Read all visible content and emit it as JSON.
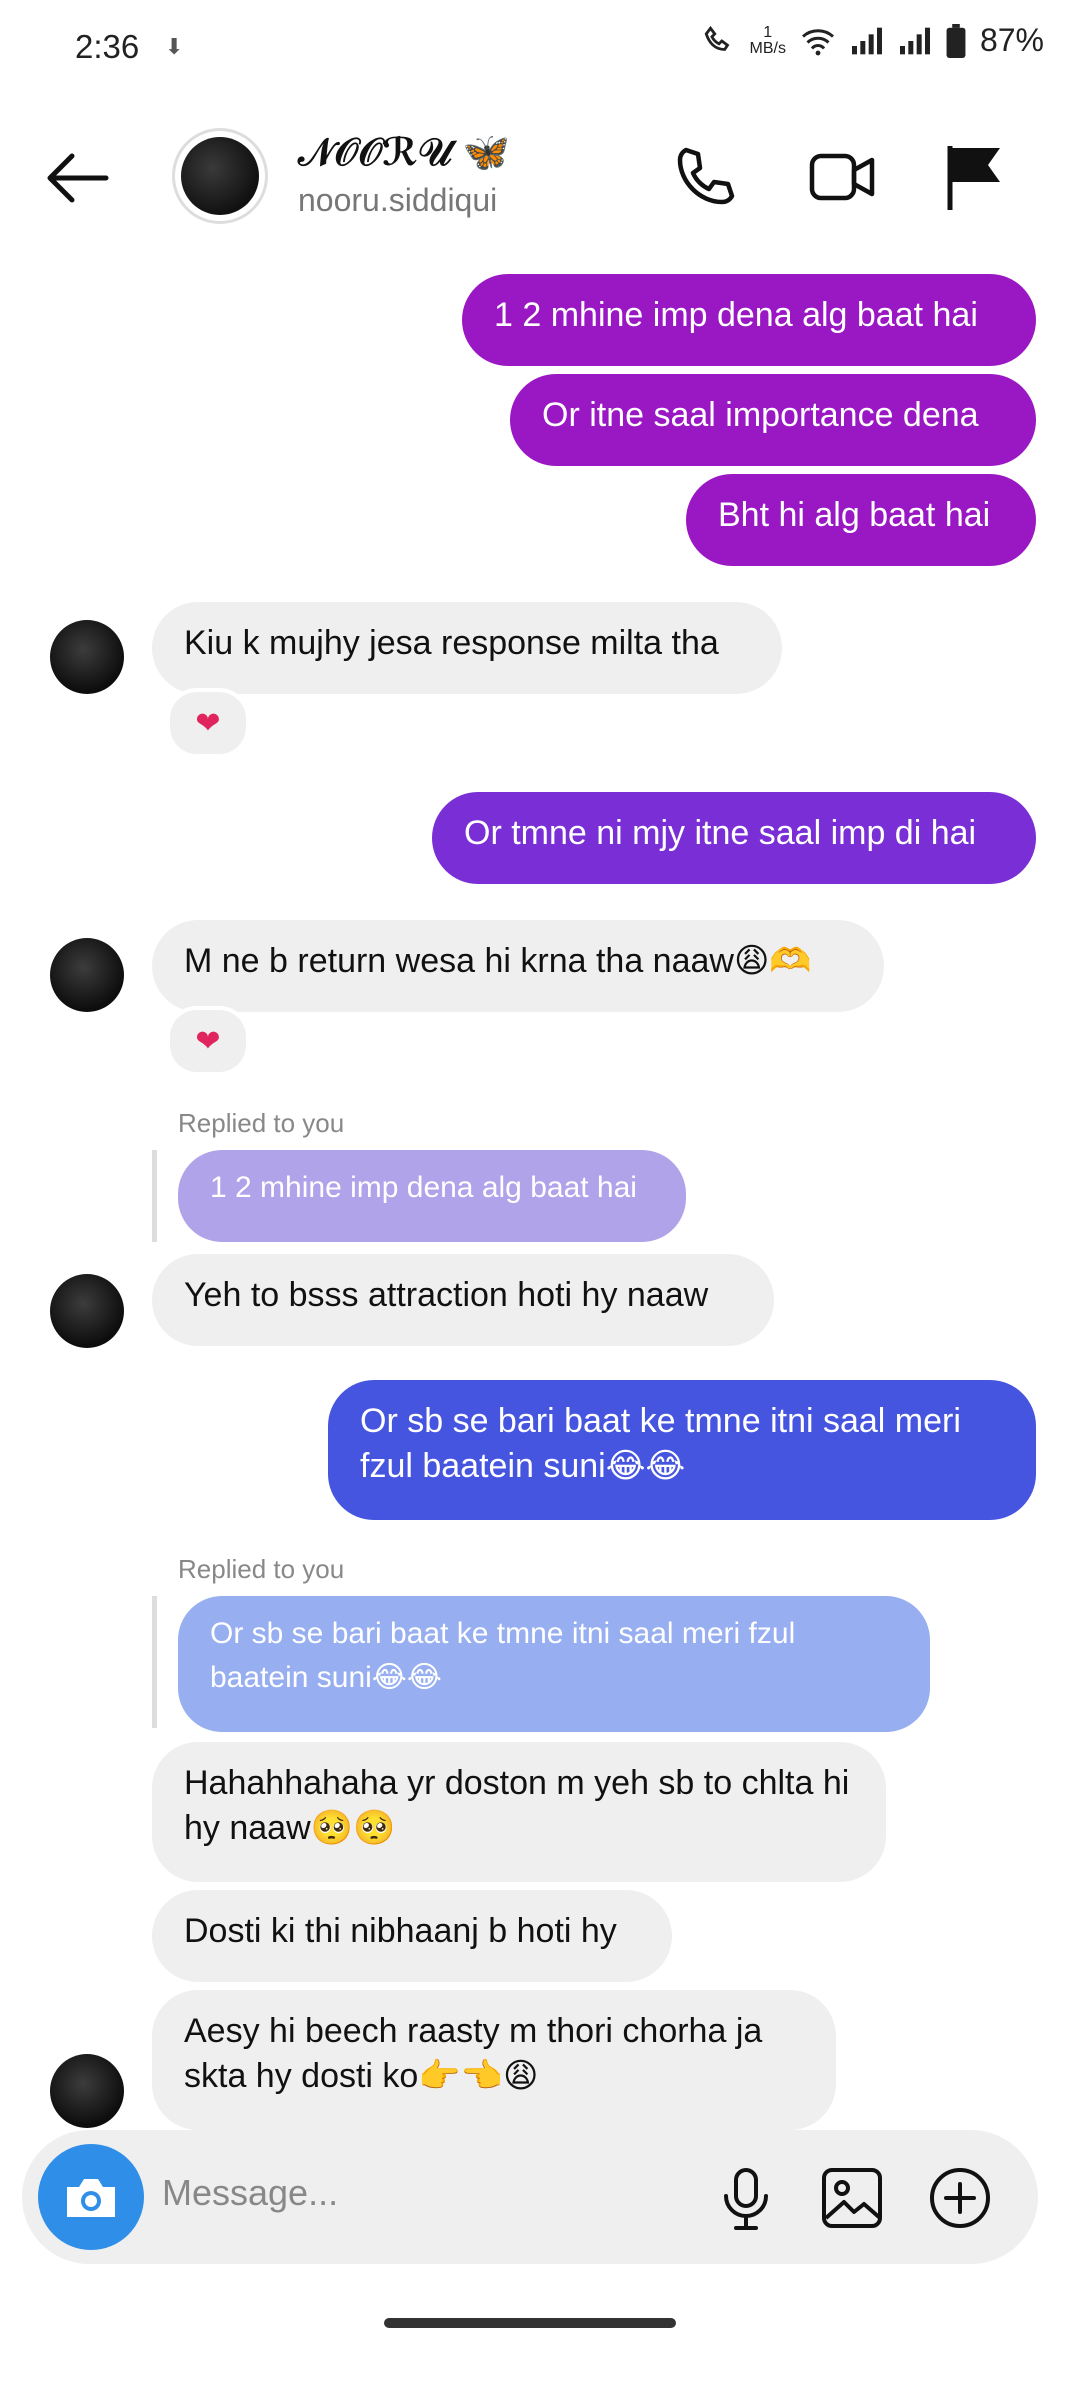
{
  "status_bar": {
    "time": "2:36",
    "speed_value": "1",
    "speed_unit": "MB/s",
    "battery": "87%"
  },
  "header": {
    "display_name": "𝒩𝒪𝒪ℛ𝒰 🦋",
    "username": "nooru.siddiqui"
  },
  "messages": {
    "m1": "1 2 mhine imp dena alg baat hai",
    "m2": "Or itne saal importance dena",
    "m3": "Bht hi alg baat hai",
    "m4": "Kiu k mujhy jesa response milta tha",
    "m5": "Or tmne ni mjy itne saal imp di hai",
    "m6": "M ne b return wesa hi krna tha naaw😩🫶",
    "m7": "Yeh to bsss attraction hoti hy naaw",
    "m8": "Or sb se bari baat ke tmne itni saal meri fzul baatein suni😂😂",
    "m9": "Hahahhahaha yr doston m yeh sb to chlta hi hy naaw🥺🥺",
    "m10": "Dosti ki thi nibhaanj b hoti hy",
    "m11": "Aesy hi beech raasty m thori chorha ja skta hy dosti ko👉👈😩"
  },
  "reactions": {
    "r1": "❤",
    "r2": "❤"
  },
  "replies": {
    "label1": "Replied to you",
    "quote1": "1 2 mhine imp dena alg baat hai",
    "label2": "Replied to you",
    "quote2": "Or sb se bari baat ke tmne itni saal meri fzul baatein suni😂😂"
  },
  "composer": {
    "placeholder": "Message..."
  },
  "colors": {
    "purple": "#9a17c4",
    "violet": "#7a2fd6",
    "blue": "#4655e0",
    "quote_purple": "#b0a3ea",
    "quote_blue": "#97aef0"
  }
}
